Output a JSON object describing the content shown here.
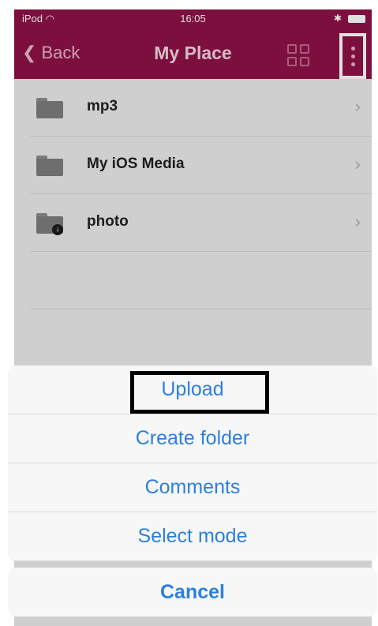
{
  "status_bar": {
    "carrier": "iPod",
    "time": "16:05"
  },
  "nav": {
    "back_label": "Back",
    "title": "My Place"
  },
  "folders": [
    {
      "label": "mp3"
    },
    {
      "label": "My iOS Media"
    },
    {
      "label": "photo"
    }
  ],
  "action_sheet": {
    "items": [
      "Upload",
      "Create folder",
      "Comments",
      "Select mode"
    ],
    "cancel": "Cancel"
  },
  "colors": {
    "nav_bar": "#8f1248",
    "action_text": "#2c7fe0"
  },
  "icons": [
    "wifi-icon",
    "bluetooth-icon",
    "battery-icon",
    "chevron-left-icon",
    "grid-view-icon",
    "more-vertical-icon",
    "folder-icon",
    "download-badge-icon",
    "chevron-right-icon"
  ]
}
